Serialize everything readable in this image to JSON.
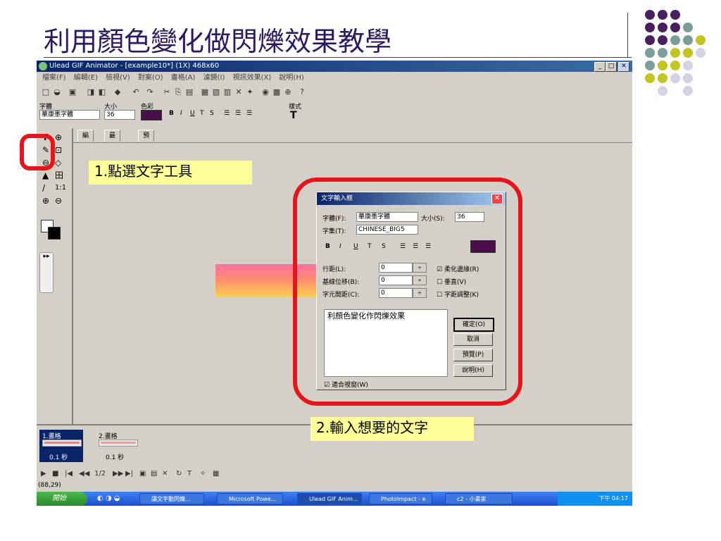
{
  "slide": {
    "title": "利用顏色變化做閃爍效果教學",
    "dot_colors": [
      "#4a1f5f",
      "#7a9e9a",
      "#c3c322",
      "#d3d3e6"
    ]
  },
  "app": {
    "title": "Ulead GIF Animator - [example10*] (1X) 468x60",
    "menu": [
      "檔案(F)",
      "編輯(E)",
      "檢視(V)",
      "對案(O)",
      "畫格(A)",
      "濾鏡(I)",
      "視訊效果(X)",
      "說明(H)"
    ],
    "font_label": "字體",
    "font_value": "華康墨字體",
    "size_label": "大小",
    "size_value": "36",
    "color_label": "色彩",
    "style_label": "樣式",
    "format_buttons": [
      "B",
      "I",
      "U",
      "T",
      "S"
    ],
    "tabs": [
      "編輯",
      "最佳化",
      "預覽"
    ],
    "left_tools": [
      "T",
      "⊕",
      "✎",
      "⊡",
      "⊖",
      "◇",
      "▲",
      "田",
      "/",
      "1:1",
      "⊕",
      "⊖"
    ],
    "frames": [
      {
        "label": "1.畫格",
        "time": "0.1 秒"
      },
      {
        "label": "2.畫格",
        "time": "0.1 秒"
      }
    ],
    "play_counter": "1/2",
    "status_coord": "(88,29)",
    "taskbar": {
      "start": "開始",
      "buttons": [
        "讓文字動閃爍...",
        "Microsoft Powe...",
        "Ulead GIF Anim...",
        "PhotoImpact - e",
        "c2 - 小畫家"
      ],
      "clock": "下午 04:17"
    }
  },
  "dialog": {
    "title": "文字輸入框",
    "font_label": "字體(F):",
    "font_value": "華康墨字體",
    "size_label": "大小(S):",
    "size_value": "36",
    "charset_label": "字集(T):",
    "charset_value": "CHINESE_BIG5",
    "line_spacing_label": "行距(L):",
    "baseline_label": "基線位移(B):",
    "char_spacing_label": "字元間距(C):",
    "zero": "0",
    "antialias_label": "柔化邊緣(R)",
    "vertical_label": "垂直(V)",
    "kerning_label": "字距調整(K)",
    "text_content": "利顏色變化作閃爍效果",
    "ok_button": "確定(O)",
    "cancel_button": "取消",
    "preview_button": "預覽(P)",
    "help_button": "說明(H)",
    "fit_label": "適合視窗(W)"
  },
  "annotations": {
    "step1": "1.點選文字工具",
    "step2": "2.輸入想要的文字"
  }
}
